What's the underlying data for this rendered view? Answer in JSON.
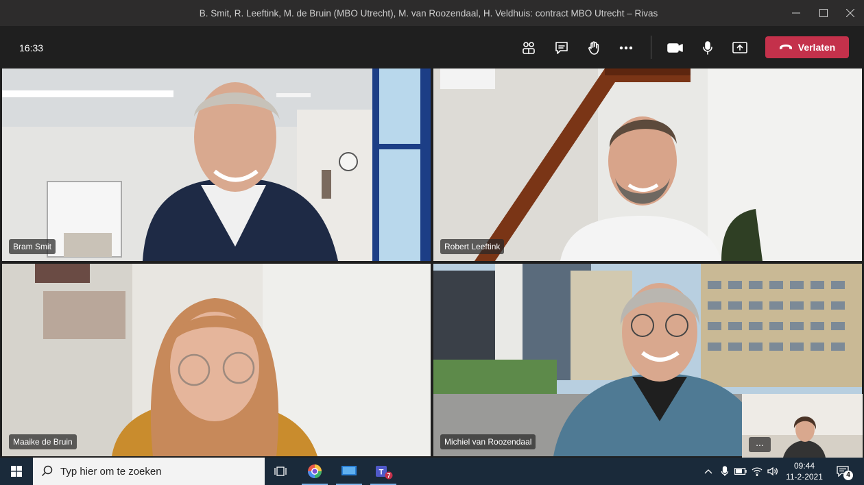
{
  "window": {
    "title": "B. Smit, R. Leeftink, M. de Bruin (MBO Utrecht), M. van Roozendaal, H. Veldhuis: contract MBO Utrecht – Rivas"
  },
  "meeting": {
    "elapsed": "16:33",
    "leave_label": "Verlaten"
  },
  "participants": [
    {
      "name": "Bram Smit"
    },
    {
      "name": "Robert Leeftink"
    },
    {
      "name": "Maaike de Bruin"
    },
    {
      "name": "Michiel van Roozendaal"
    }
  ],
  "selfview": {
    "more_label": "..."
  },
  "taskbar": {
    "search_placeholder": "Typ hier om te zoeken",
    "teams_badge": "7",
    "time": "09:44",
    "date": "11-2-2021",
    "notifications_count": "4"
  },
  "icons": {
    "colors": {
      "leave": "#c4314b",
      "taskbar": "#1a2a3a",
      "titlebar": "#2d2c2c"
    }
  }
}
